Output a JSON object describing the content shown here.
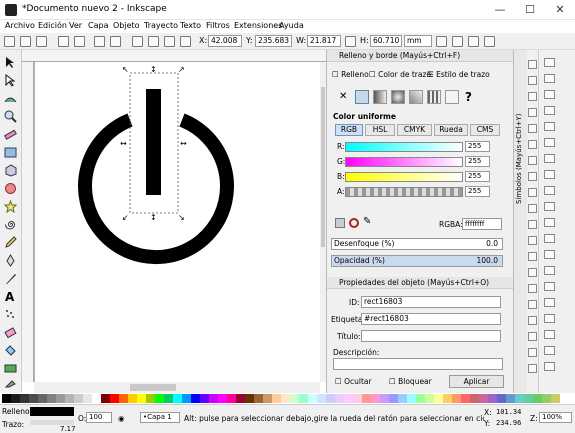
{
  "window": {
    "title": "*Documento nuevo 2 - Inkscape",
    "minimize": "—",
    "maximize": "☐",
    "close": "✕"
  },
  "menu": [
    "Archivo",
    "Edición",
    "Ver",
    "Capa",
    "Objeto",
    "Trayecto",
    "Texto",
    "Filtros",
    "Extensiones",
    "Ayuda"
  ],
  "toolbar": {
    "x_label": "X:",
    "x_value": "42.008",
    "y_label": "Y:",
    "y_value": "235.683",
    "w_label": "W:",
    "w_value": "21.817",
    "h_label": "H:",
    "h_value": "60.710",
    "unit": "mm"
  },
  "fill_stroke": {
    "header": "Relleno y borde (Mayús+Ctrl+F)",
    "tabs": [
      "Relleno",
      "Color de trazo",
      "Estilo de trazo"
    ],
    "unknown_paint": "?",
    "color_label": "Color uniforme",
    "modes": [
      "RGB",
      "HSL",
      "CMYK",
      "Rueda",
      "CMS"
    ],
    "channels": [
      {
        "label": "R:",
        "value": "255"
      },
      {
        "label": "G:",
        "value": "255"
      },
      {
        "label": "B:",
        "value": "255"
      },
      {
        "label": "A:",
        "value": "255"
      }
    ],
    "rgba_label": "RGBA:",
    "rgba_value": "ffffffff",
    "blur_label": "Desenfoque (%)",
    "blur_value": "0.0",
    "opacity_label": "Opacidad (%)",
    "opacity_value": "100.0"
  },
  "object_props": {
    "header": "Propiedades del objeto (Mayús+Ctrl+O)",
    "id_label": "ID:",
    "id_value": "rect16803",
    "label_label": "Etiqueta:",
    "label_value": "#rect16803",
    "title_label": "Título:",
    "title_value": "",
    "desc_label": "Descripción:",
    "hide_label": "Ocultar",
    "lock_label": "Bloquear",
    "apply_label": "Aplicar"
  },
  "side_tab": "Símbolos (Mayús+Ctrl+Y)",
  "palette_colors": [
    "#000000",
    "#1a1a1a",
    "#333333",
    "#4d4d4d",
    "#666666",
    "#808080",
    "#999999",
    "#b3b3b3",
    "#cccccc",
    "#e6e6e6",
    "#ffffff",
    "#800000",
    "#ff0000",
    "#ff6600",
    "#ffcc00",
    "#ffff00",
    "#99cc00",
    "#00ff00",
    "#00cc66",
    "#00ffff",
    "#0099ff",
    "#0000ff",
    "#6600ff",
    "#cc00ff",
    "#ff00ff",
    "#ff0099",
    "#990033",
    "#663300",
    "#996633",
    "#cc9966",
    "#ffcc99",
    "#ffe6cc",
    "#ccffcc",
    "#99ffcc",
    "#ccffff",
    "#cce6ff",
    "#ccccff",
    "#e6ccff",
    "#ffccff",
    "#ffcce6",
    "#ff9999",
    "#ff99cc",
    "#cc99ff",
    "#9999ff",
    "#99ccff",
    "#99ffff",
    "#99ff99",
    "#ccff99",
    "#ffff99",
    "#ffcc66",
    "#ff9966",
    "#ff6666",
    "#cc6666",
    "#cc6699",
    "#9966cc",
    "#6666cc",
    "#6699cc",
    "#66cccc",
    "#66cc99",
    "#66cc66",
    "#99cc66",
    "#cccc66"
  ],
  "status": {
    "fill_label": "Relleno:",
    "stroke_label": "Trazo:",
    "stroke_value": "7.17",
    "opacity_label": "O:",
    "opacity_value": "100",
    "layer": "•Capa 1",
    "message": "Alt: pulse para seleccionar debajo,gire la rueda del ratón para seleccionar en ciclo; arrastre par...",
    "x_label": "X:",
    "x_value": "101.34",
    "y_label": "Y:",
    "y_value": "234.96",
    "zoom_label": "Z:",
    "zoom_value": "100%"
  }
}
